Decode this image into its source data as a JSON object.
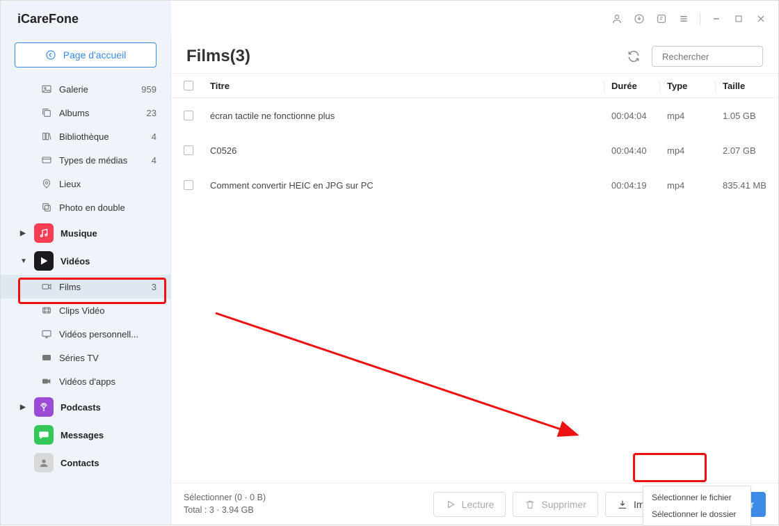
{
  "app_title": "iCareFone",
  "home_button": "Page d'accueil",
  "sidebar": {
    "photos": [
      {
        "icon": "gallery",
        "label": "Galerie",
        "count": "959"
      },
      {
        "icon": "albums",
        "label": "Albums",
        "count": "23"
      },
      {
        "icon": "library",
        "label": "Bibliothèque",
        "count": "4"
      },
      {
        "icon": "mediatypes",
        "label": "Types de médias",
        "count": "4"
      },
      {
        "icon": "places",
        "label": "Lieux",
        "count": ""
      },
      {
        "icon": "duplicate",
        "label": "Photo en double",
        "count": ""
      }
    ],
    "music": {
      "label": "Musique"
    },
    "videos": {
      "label": "Vidéos"
    },
    "video_subs": [
      {
        "icon": "camera",
        "label": "Films",
        "count": "3",
        "active": true
      },
      {
        "icon": "clip",
        "label": "Clips Vidéo",
        "count": ""
      },
      {
        "icon": "monitor",
        "label": "Vidéos personnell...",
        "count": ""
      },
      {
        "icon": "tv",
        "label": "Séries TV",
        "count": ""
      },
      {
        "icon": "appvideo",
        "label": "Vidéos d'apps",
        "count": ""
      }
    ],
    "podcasts": {
      "label": "Podcasts"
    },
    "messages": {
      "label": "Messages"
    },
    "contacts": {
      "label": "Contacts"
    }
  },
  "main": {
    "title": "Films(3)",
    "search_placeholder": "Rechercher",
    "columns": {
      "title": "Titre",
      "duration": "Durée",
      "type": "Type",
      "size": "Taille"
    },
    "rows": [
      {
        "title": "écran tactile ne fonctionne plus",
        "duration": "00:04:04",
        "type": "mp4",
        "size": "1.05 GB"
      },
      {
        "title": "C0526",
        "duration": "00:04:40",
        "type": "mp4",
        "size": "2.07 GB"
      },
      {
        "title": "Comment convertir HEIC en JPG sur PC",
        "duration": "00:04:19",
        "type": "mp4",
        "size": "835.41 MB"
      }
    ],
    "footer": {
      "selection": "Sélectionner (0 · 0 B)",
      "total": "Total : 3 · 3.94 GB",
      "play": "Lecture",
      "delete": "Supprimer",
      "import": "Importer",
      "export": "Exporter"
    },
    "dropdown": {
      "file": "Sélectionner le fichier",
      "folder": "Sélectionner le dossier"
    }
  }
}
